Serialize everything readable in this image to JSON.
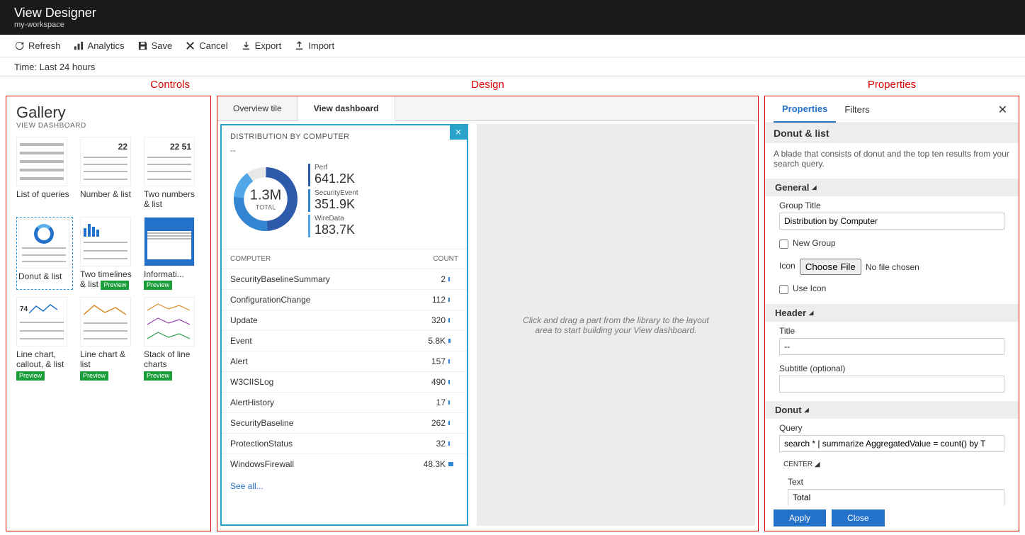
{
  "header": {
    "title": "View Designer",
    "subtitle": "my-workspace"
  },
  "toolbar": {
    "refresh": "Refresh",
    "analytics": "Analytics",
    "save": "Save",
    "cancel": "Cancel",
    "export": "Export",
    "import": "Import"
  },
  "timebar": "Time: Last 24 hours",
  "annotations": {
    "controls": "Controls",
    "design": "Design",
    "properties": "Properties"
  },
  "gallery": {
    "title": "Gallery",
    "subtitle": "VIEW DASHBOARD",
    "items": [
      {
        "label": "List of queries"
      },
      {
        "label": "Number & list",
        "num": "22"
      },
      {
        "label": "Two numbers & list",
        "num": "22  51"
      },
      {
        "label": "Donut & list"
      },
      {
        "label": "Two timelines & list",
        "preview": "Preview"
      },
      {
        "label": "Informati...",
        "preview": "Preview"
      },
      {
        "label": "Line chart, callout, & list",
        "preview": "Preview",
        "callout": "74"
      },
      {
        "label": "Line chart & list",
        "preview": "Preview"
      },
      {
        "label": "Stack of line charts",
        "preview": "Preview"
      }
    ]
  },
  "design": {
    "tabs": [
      {
        "label": "Overview tile"
      },
      {
        "label": "View dashboard",
        "active": true
      }
    ],
    "card": {
      "title": "DISTRIBUTION BY COMPUTER",
      "subtitle": "--",
      "donut": {
        "center_value": "1.3M",
        "center_label": "TOTAL"
      },
      "series": [
        {
          "name": "Perf",
          "value": "641.2K",
          "color": "#2e5aab"
        },
        {
          "name": "SecurityEvent",
          "value": "351.9K",
          "color": "#3285d1"
        },
        {
          "name": "WireData",
          "value": "183.7K",
          "color": "#52a7e8"
        }
      ],
      "columns": {
        "c1": "COMPUTER",
        "c2": "COUNT"
      },
      "rows": [
        {
          "name": "SecurityBaselineSummary",
          "count": "2",
          "bar": 2
        },
        {
          "name": "ConfigurationChange",
          "count": "112",
          "bar": 2
        },
        {
          "name": "Update",
          "count": "320",
          "bar": 2
        },
        {
          "name": "Event",
          "count": "5.8K",
          "bar": 3
        },
        {
          "name": "Alert",
          "count": "157",
          "bar": 2
        },
        {
          "name": "W3CIISLog",
          "count": "490",
          "bar": 2
        },
        {
          "name": "AlertHistory",
          "count": "17",
          "bar": 2
        },
        {
          "name": "SecurityBaseline",
          "count": "262",
          "bar": 2
        },
        {
          "name": "ProtectionStatus",
          "count": "32",
          "bar": 2
        },
        {
          "name": "WindowsFirewall",
          "count": "48.3K",
          "bar": 7
        }
      ],
      "see_all": "See all..."
    },
    "drop_hint": "Click and drag a part from the library to the layout area to start building your View dashboard."
  },
  "properties": {
    "tabs": {
      "properties": "Properties",
      "filters": "Filters"
    },
    "heading": "Donut & list",
    "description": "A blade that consists of donut and the top ten results from your search query.",
    "sections": {
      "general": {
        "title": "General",
        "group_title_label": "Group Title",
        "group_title_value": "Distribution by Computer",
        "new_group_label": "New Group",
        "icon_label": "Icon",
        "choose_file": "Choose File",
        "no_file": "No file chosen",
        "use_icon_label": "Use Icon"
      },
      "header": {
        "title": "Header",
        "title_label": "Title",
        "title_value": "--",
        "subtitle_label": "Subtitle (optional)",
        "subtitle_value": ""
      },
      "donut": {
        "title": "Donut",
        "query_label": "Query",
        "query_value": "search * | summarize AggregatedValue = count() by T",
        "center_title": "CENTER",
        "text_label": "Text",
        "text_value": "Total"
      }
    },
    "footer": {
      "apply": "Apply",
      "close": "Close"
    }
  },
  "chart_data": {
    "type": "pie",
    "title": "DISTRIBUTION BY COMPUTER",
    "total_label": "TOTAL",
    "total_value": 1300000,
    "series": [
      {
        "name": "Perf",
        "value": 641200
      },
      {
        "name": "SecurityEvent",
        "value": 351900
      },
      {
        "name": "WireData",
        "value": 183700
      }
    ],
    "list": {
      "columns": [
        "COMPUTER",
        "COUNT"
      ],
      "rows": [
        [
          "SecurityBaselineSummary",
          2
        ],
        [
          "ConfigurationChange",
          112
        ],
        [
          "Update",
          320
        ],
        [
          "Event",
          5800
        ],
        [
          "Alert",
          157
        ],
        [
          "W3CIISLog",
          490
        ],
        [
          "AlertHistory",
          17
        ],
        [
          "SecurityBaseline",
          262
        ],
        [
          "ProtectionStatus",
          32
        ],
        [
          "WindowsFirewall",
          48300
        ]
      ]
    }
  }
}
